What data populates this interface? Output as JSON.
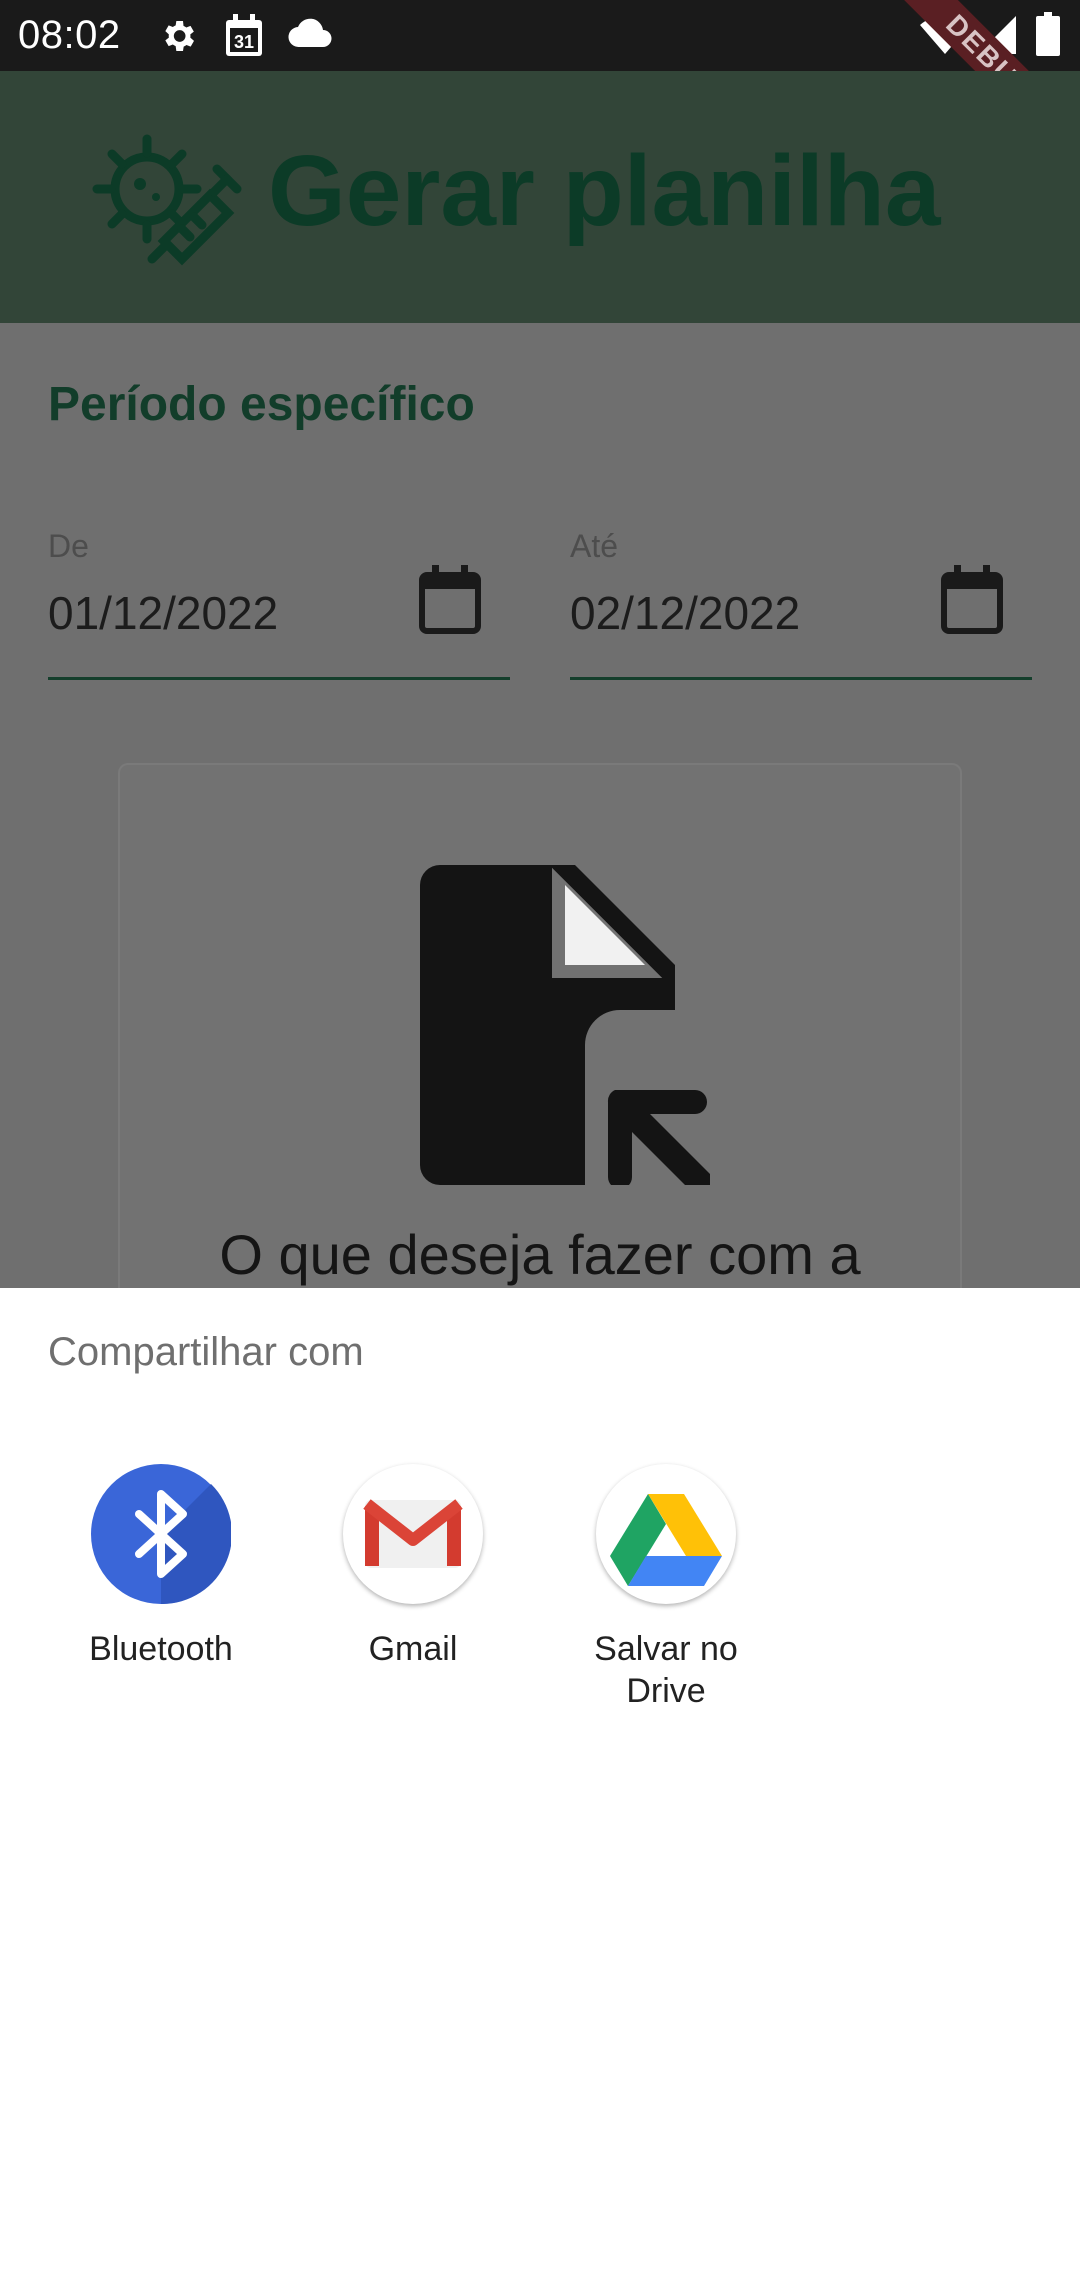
{
  "status_bar": {
    "time": "08:02",
    "left_icons": [
      "settings-icon",
      "calendar-31-icon",
      "cloud-icon"
    ],
    "right_icons": [
      "wifi-icon",
      "signal-icon",
      "battery-icon"
    ],
    "debug_label": "DEBUG",
    "calendar_day": "31"
  },
  "app_bar": {
    "title": "Gerar planilha",
    "logo_icon": "virus-syringe-icon",
    "color": "#0c3b27"
  },
  "form": {
    "section_title": "Período específico",
    "from": {
      "label": "De",
      "value": "01/12/2022",
      "icon": "calendar-icon"
    },
    "to": {
      "label": "Até",
      "value": "02/12/2022",
      "icon": "calendar-icon"
    }
  },
  "card": {
    "icon": "file-open-icon",
    "question": "O que deseja fazer com a"
  },
  "share_sheet": {
    "title": "Compartilhar com",
    "targets": [
      {
        "label": "Bluetooth",
        "icon": "bluetooth-icon",
        "color": "#3a66d8"
      },
      {
        "label": "Gmail",
        "icon": "gmail-icon",
        "color": "#db4437"
      },
      {
        "label": "Salvar no Drive",
        "icon": "google-drive-icon",
        "color": "#1fa463"
      }
    ]
  }
}
